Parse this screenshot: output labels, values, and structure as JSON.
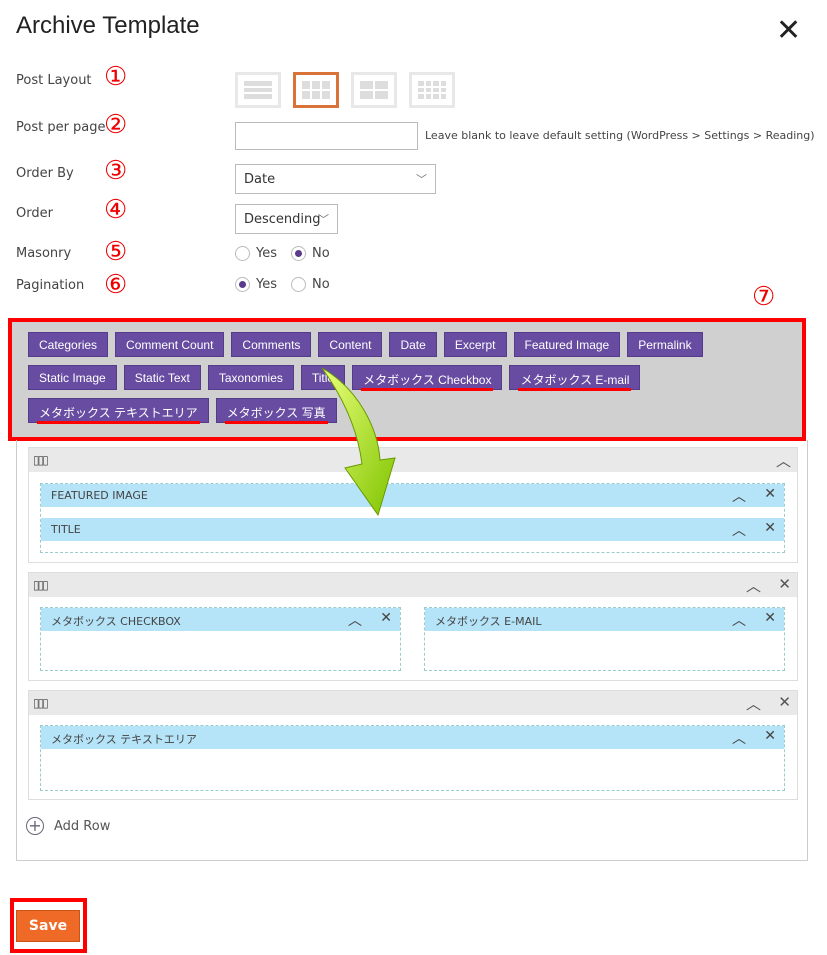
{
  "title": "Archive Template",
  "labels": {
    "post_layout": "Post Layout",
    "post_per_page": "Post per page",
    "order_by": "Order By",
    "order": "Order",
    "masonry": "Masonry",
    "pagination": "Pagination"
  },
  "annotations": [
    "①",
    "②",
    "③",
    "④",
    "⑤",
    "⑥",
    "⑦"
  ],
  "post_per_page": {
    "value": "",
    "hint": "Leave blank to leave default setting (WordPress > Settings > Reading)"
  },
  "order_by": {
    "selected": "Date"
  },
  "order": {
    "selected": "Descending"
  },
  "masonry": {
    "yes": "Yes",
    "no": "No",
    "selected": "No"
  },
  "pagination": {
    "yes": "Yes",
    "no": "No",
    "selected": "Yes"
  },
  "post_layout": {
    "options": [
      "list",
      "grid-3",
      "grid-2",
      "grid-4"
    ],
    "selected": "grid-3"
  },
  "fields": [
    "Categories",
    "Comment Count",
    "Comments",
    "Content",
    "Date",
    "Excerpt",
    "Featured Image",
    "Permalink",
    "Static Image",
    "Static Text",
    "Taxonomies",
    "Title",
    "メタボックス Checkbox",
    "メタボックス E-mail",
    "メタボックス テキストエリア",
    "メタボックス 写真"
  ],
  "rows": [
    {
      "columns": [
        [
          "FEATURED IMAGE",
          "TITLE"
        ]
      ]
    },
    {
      "columns": [
        [
          "メタボックス CHECKBOX"
        ],
        [
          "メタボックス E-MAIL"
        ]
      ]
    },
    {
      "columns": [
        [
          "メタボックス テキストエリア"
        ]
      ]
    }
  ],
  "add_row": "Add Row",
  "save": "Save",
  "colors": {
    "chip": "#674ca1",
    "save": "#ee6a26",
    "highlight": "#ff0000",
    "item": "#b5e3f7"
  }
}
